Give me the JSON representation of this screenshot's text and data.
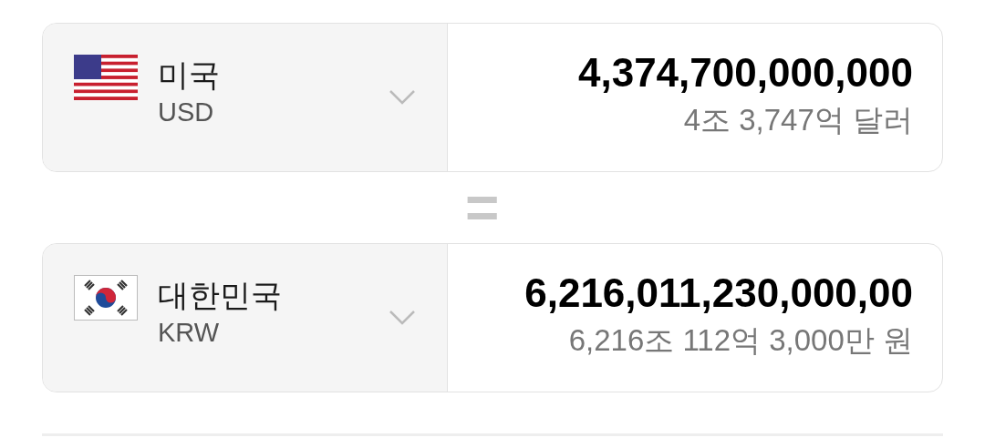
{
  "converters": [
    {
      "kind": "us",
      "country": "미국",
      "code": "USD",
      "amount": "4,374,700,000,000",
      "amount_words": "4조 3,747억 달러"
    },
    {
      "kind": "kr",
      "country": "대한민국",
      "code": "KRW",
      "amount": "6,216,011,230,000,00",
      "amount_words": "6,216조 112억 3,000만 원"
    }
  ],
  "equals": "="
}
